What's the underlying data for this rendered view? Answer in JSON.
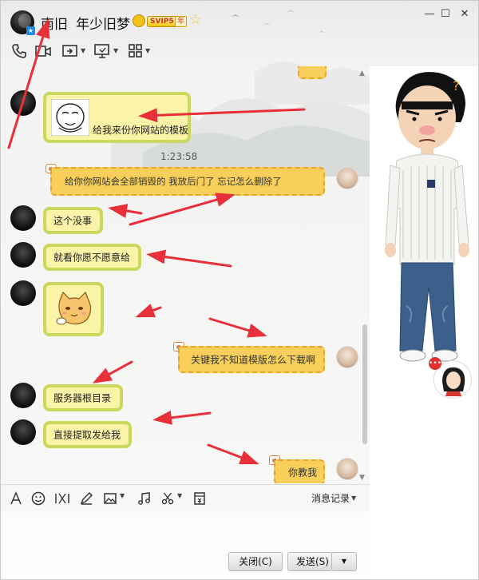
{
  "window": {
    "contact_name": "南旧",
    "signature": "年少旧梦",
    "vip_label": "SVIP5",
    "year_label": "年",
    "minimize_glyph": "—",
    "maximize_glyph": "☐",
    "close_glyph": "✕"
  },
  "toolbar": {
    "icons": [
      "phone-icon",
      "video-icon",
      "screen-share-icon",
      "remote-desktop-icon",
      "apps-grid-icon"
    ]
  },
  "messages": {
    "m1_text": "给我来份你网站的模板",
    "timestamp": "1:23:58",
    "m2_text": "给你你网站会全部销毁的    我放后门了    忘记怎么删除了",
    "m3_text": "这个没事",
    "m4_text": "就看你愿不愿意给",
    "m6_text": "关键我不知道模版怎么下载啊",
    "m7_text": "服务器根目录",
    "m8_text": "直接提取发给我",
    "m9_text": "你教我"
  },
  "input_toolbar": {
    "icons": [
      "font-icon",
      "emoji-icon",
      "gif-icon",
      "pen-icon",
      "image-icon",
      "music-icon",
      "scissors-icon",
      "red-packet-icon"
    ],
    "history_label": "消息记录"
  },
  "buttons": {
    "close_label": "关闭(C)",
    "send_label": "发送(S)",
    "send_dropdown": "▼"
  },
  "colors": {
    "my_bubble_border": "#c8d95e",
    "my_bubble_fill": "#fbf3a8",
    "peer_bubble_fill": "#f7cf5a",
    "annotation_arrow": "#e8303a"
  }
}
